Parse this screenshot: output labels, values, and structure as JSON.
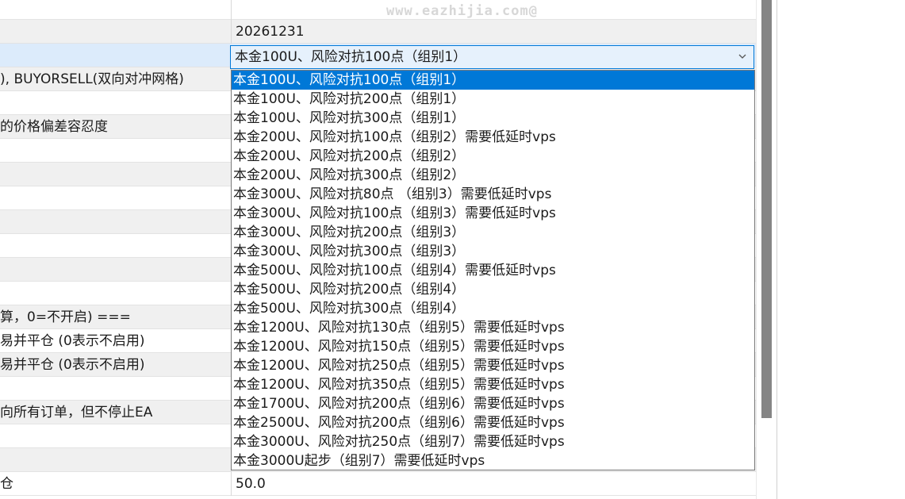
{
  "watermark": "www.eazhijia.com@",
  "rows": [
    {
      "left": "",
      "right": ""
    },
    {
      "left": "",
      "right": "20261231"
    },
    {
      "left": "",
      "right": ""
    },
    {
      "left": "), BUYORSELL(双向对冲网格)",
      "right": ""
    },
    {
      "left": "",
      "right": ""
    },
    {
      "left": "的价格偏差容忍度",
      "right": ""
    },
    {
      "left": "",
      "right": ""
    },
    {
      "left": "",
      "right": ""
    },
    {
      "left": "",
      "right": ""
    },
    {
      "left": "",
      "right": ""
    },
    {
      "left": "",
      "right": ""
    },
    {
      "left": "",
      "right": ""
    },
    {
      "left": "",
      "right": ""
    },
    {
      "left": "算，0=不开启) ===",
      "right": ""
    },
    {
      "left": "易并平仓 (0表示不启用)",
      "right": ""
    },
    {
      "left": "易并平仓 (0表示不启用)",
      "right": ""
    },
    {
      "left": "",
      "right": ""
    },
    {
      "left": "向所有订单，但不停止EA",
      "right": ""
    },
    {
      "left": "",
      "right": ""
    },
    {
      "left": "",
      "right": ""
    },
    {
      "left": "仓",
      "right": "50.0"
    }
  ],
  "combo": {
    "value": "本金100U、风险对抗100点（组别1）"
  },
  "options": [
    "本金100U、风险对抗100点（组别1）",
    "本金100U、风险对抗200点（组别1）",
    "本金100U、风险对抗300点（组别1）",
    "本金200U、风险对抗100点（组别2）需要低延时vps",
    "本金200U、风险对抗200点（组别2）",
    "本金200U、风险对抗300点（组别2）",
    "本金300U、风险对抗80点 （组别3）需要低延时vps",
    "本金300U、风险对抗100点（组别3）需要低延时vps",
    "本金300U、风险对抗200点（组别3）",
    "本金300U、风险对抗300点（组别3）",
    "本金500U、风险对抗100点（组别4）需要低延时vps",
    "本金500U、风险对抗200点（组别4）",
    "本金500U、风险对抗300点（组别4）",
    "本金1200U、风险对抗130点（组别5）需要低延时vps",
    "本金1200U、风险对抗150点（组别5）需要低延时vps",
    "本金1200U、风险对抗250点（组别5）需要低延时vps",
    "本金1200U、风险对抗350点（组别5）需要低延时vps",
    "本金1700U、风险对抗200点（组别6）需要低延时vps",
    "本金2500U、风险对抗200点（组别6）需要低延时vps",
    "本金3000U、风险对抗250点（组别7）需要低延时vps",
    "本金3000U起步（组别7）需要低延时vps"
  ],
  "selected_option_index": 0,
  "colors": {
    "selection": "#0078d7",
    "alt_row": "#f0f0f0",
    "selected_row": "#dcebfb"
  }
}
